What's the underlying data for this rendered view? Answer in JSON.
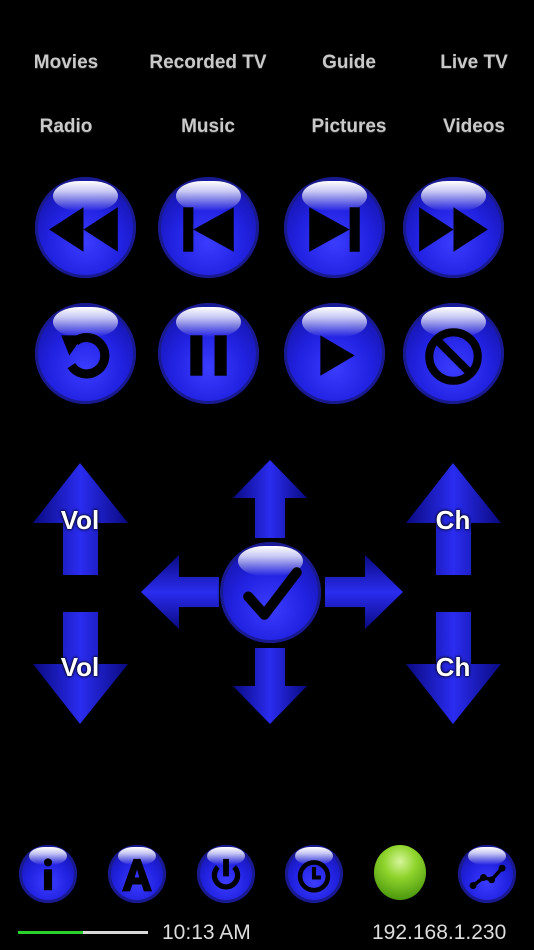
{
  "nav_row1": [
    "Movies",
    "Recorded TV",
    "Guide",
    "Live TV"
  ],
  "nav_row2": [
    "Radio",
    "Music",
    "Pictures",
    "Videos"
  ],
  "transport_icons": [
    "rewind-icon",
    "skip-back-icon",
    "skip-forward-icon",
    "fast-forward-icon"
  ],
  "control_icons": [
    "replay-icon",
    "pause-icon",
    "play-icon",
    "stop-icon"
  ],
  "volume": {
    "up_label": "Vol",
    "down_label": "Vol"
  },
  "channel": {
    "up_label": "Ch",
    "down_label": "Ch"
  },
  "dpad": {
    "ok_icon": "checkmark-icon"
  },
  "bottom_icons": [
    "info-icon",
    "letter-a-icon",
    "power-icon",
    "clock-icon",
    "status-light-icon",
    "connection-icon"
  ],
  "status_bar": {
    "time": "10:13 AM",
    "ip": "192.168.1.230",
    "progress_fraction": 0.5
  },
  "colors": {
    "button_blue": "#2121e0",
    "status_light": "#6fbf1f",
    "progress": "#2bd22b"
  }
}
